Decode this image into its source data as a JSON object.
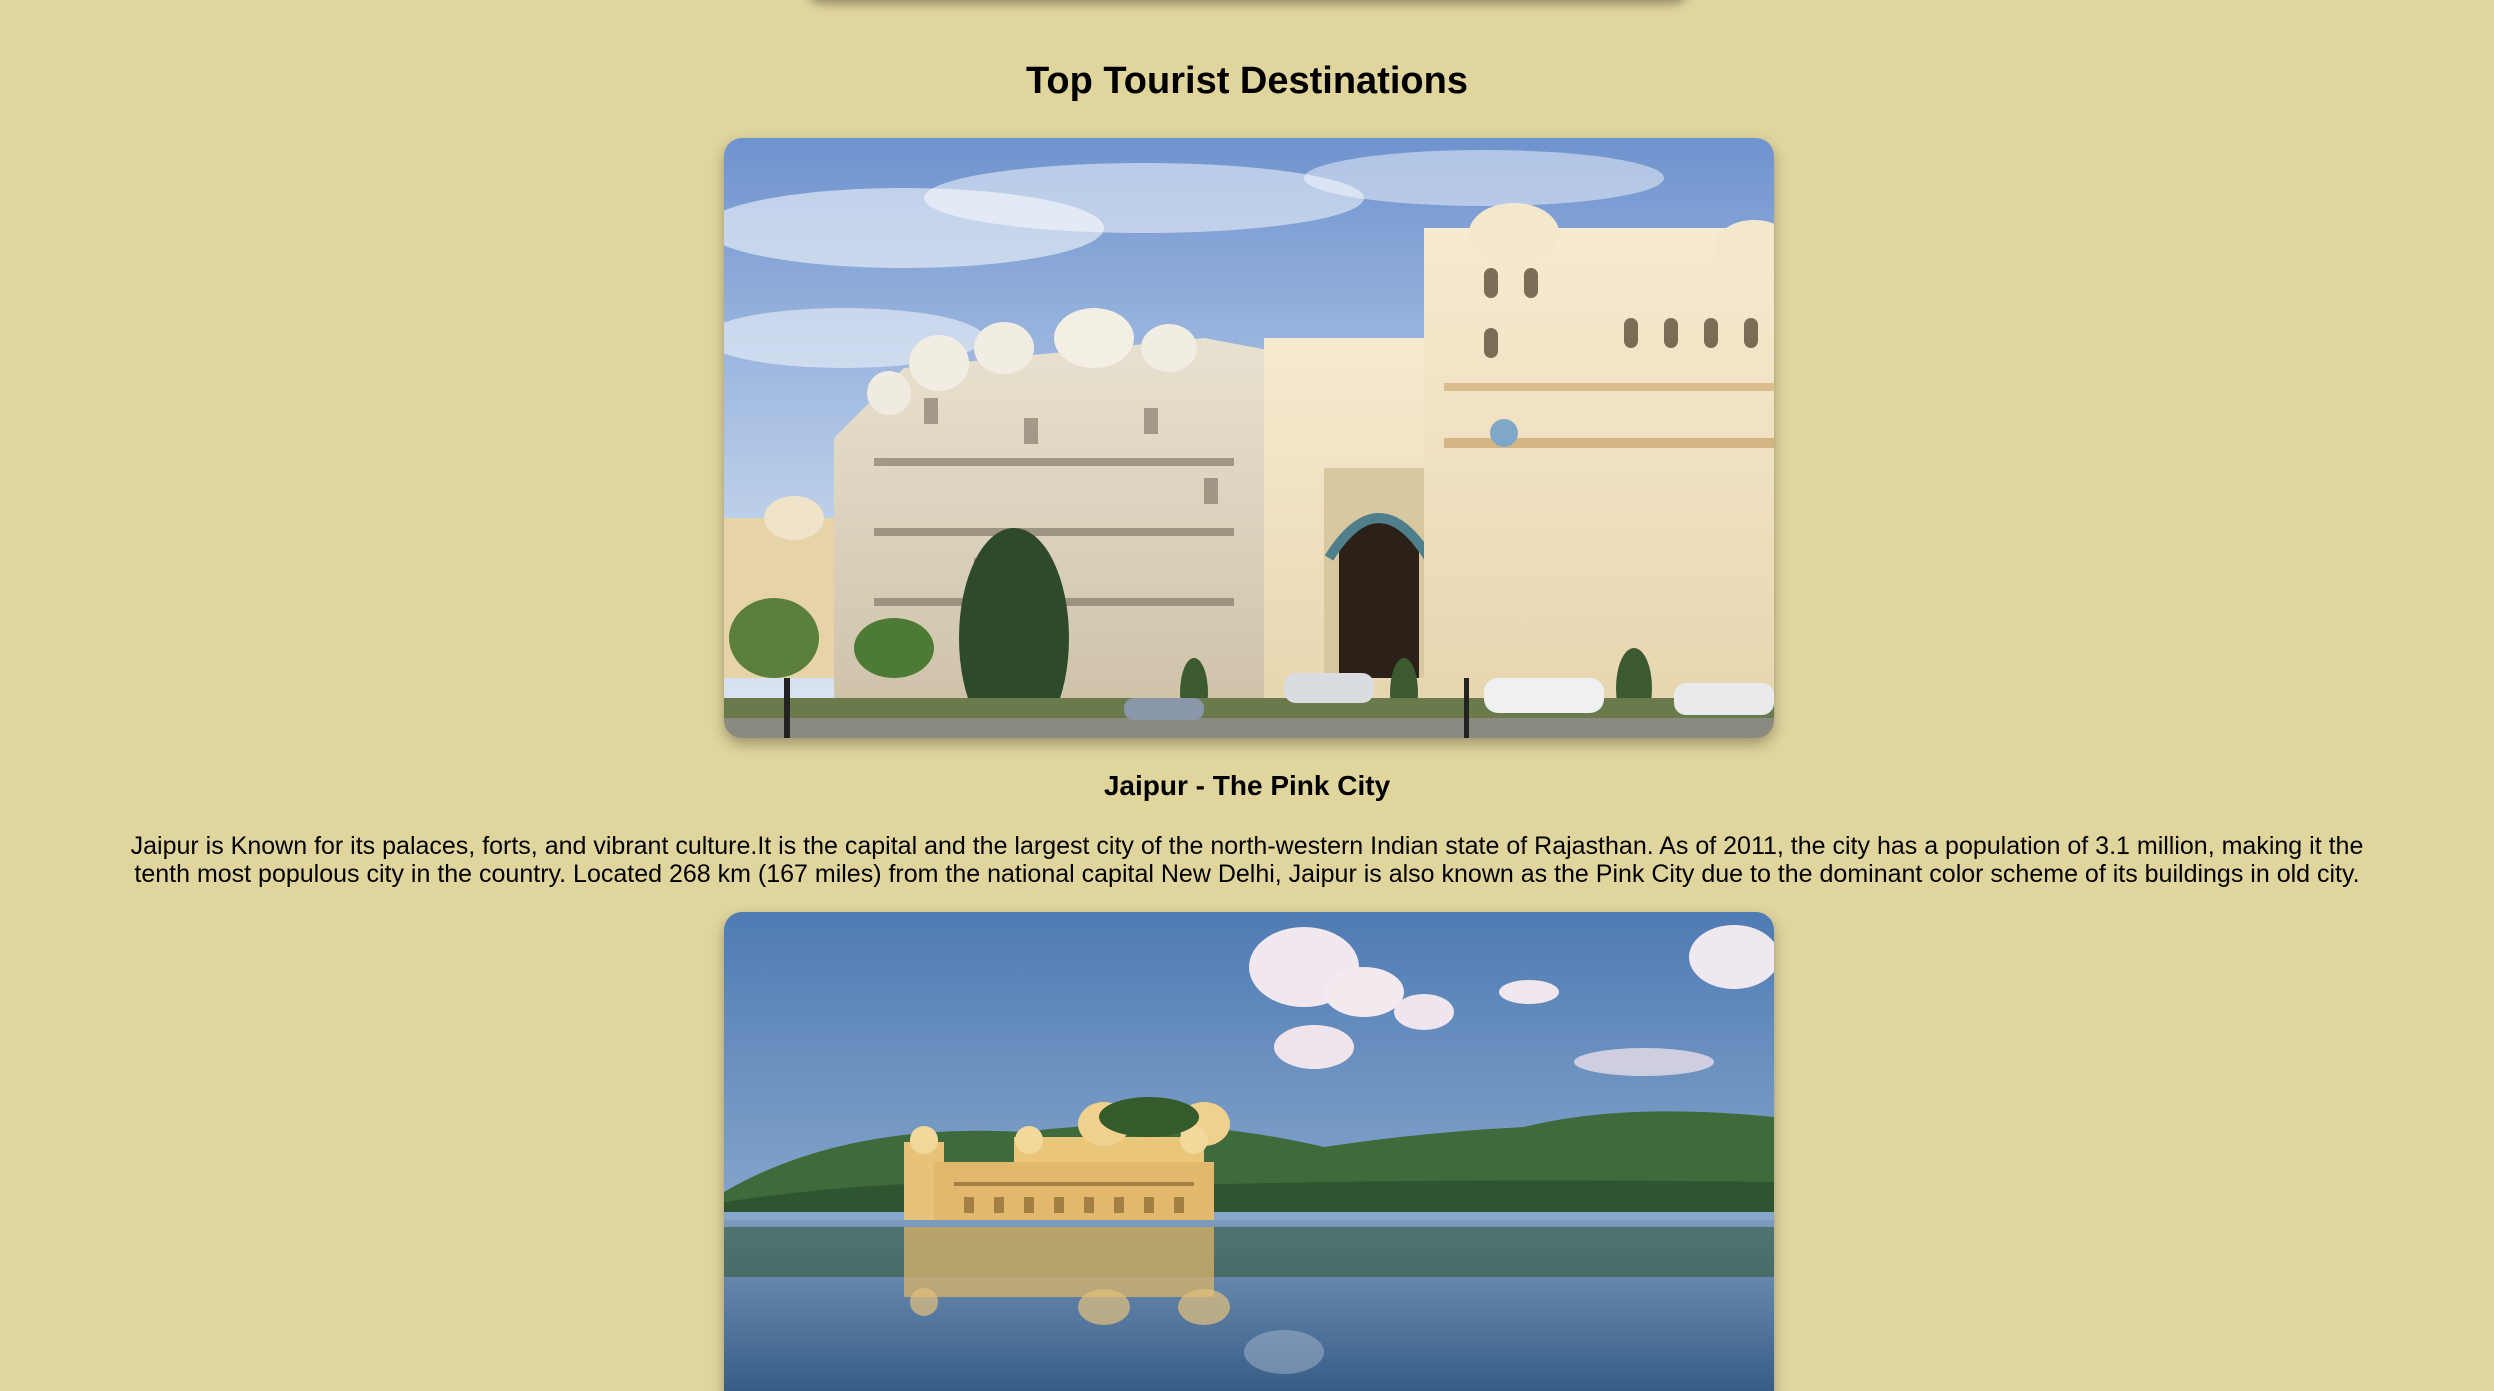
{
  "page": {
    "background_color": "#e1d59e",
    "section_title": "Top Tourist Destinations"
  },
  "destinations": [
    {
      "image_icon": "palace-photo",
      "name": "Jaipur - The Pink City",
      "description": "Jaipur is Known for its palaces, forts, and vibrant culture.It is the capital and the largest city of the north-western Indian state of Rajasthan. As of 2011, the city has a population of 3.1 million, making it the tenth most populous city in the country. Located 268 km (167 miles) from the national capital New Delhi, Jaipur is also known as the Pink City due to the dominant color scheme of its buildings in old city."
    },
    {
      "image_icon": "water-palace-photo"
    }
  ]
}
